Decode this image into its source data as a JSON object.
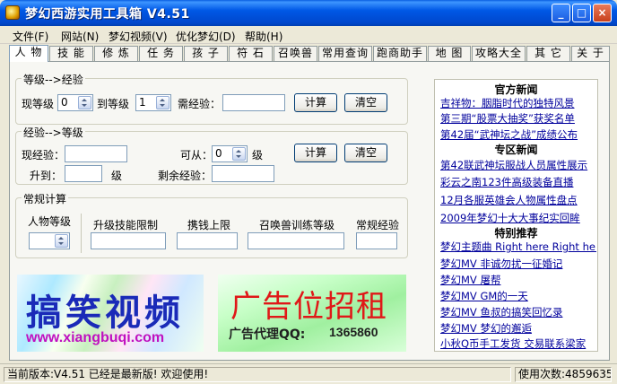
{
  "window": {
    "title": "梦幻西游实用工具箱 V4.51",
    "min_glyph": "_",
    "max_glyph": "□",
    "close_glyph": "×"
  },
  "menu": [
    "文件(F)",
    "网站(N)",
    "梦幻视频(V)",
    "优化梦幻(D)",
    "帮助(H)"
  ],
  "tabs": [
    "人 物",
    "技 能",
    "修 炼",
    "任 务",
    "孩 子",
    "符 石",
    "召唤兽",
    "常用查询",
    "跑商助手",
    "地 图",
    "攻略大全",
    "其 它",
    "关 于"
  ],
  "exp_calc": {
    "title": "等级-->经验",
    "current_level_label": "现等级",
    "current_level_value": "0",
    "to_level_label": "到等级",
    "to_level_value": "1",
    "need_exp_label": "需经验：",
    "need_exp_value": "",
    "calc_button": "计算",
    "clear_button": "清空"
  },
  "level_calc": {
    "title": "经验-->等级",
    "current_exp_label": "现经验：",
    "current_exp_value": "",
    "from_label": "可从：",
    "from_value": "0",
    "level_unit": "级",
    "up_to_label": "升到：",
    "up_to_value": "",
    "up_to_unit": "级",
    "remaining_exp_label": "剩余经验：",
    "remaining_exp_value": "",
    "calc_button": "计算",
    "clear_button": "清空"
  },
  "regular_calc": {
    "title": "常规计算",
    "char_level_label": "人物等级",
    "char_level_value": "",
    "skill_limit_label": "升级技能限制",
    "money_limit_label": "携钱上限",
    "pet_training_label": "召唤兽训练等级",
    "regular_exp_label": "常规经验"
  },
  "banners": {
    "video_title": "搞笑视频",
    "video_url": "www.xiangbuqi.com",
    "ad_title": "广告位招租",
    "ad_sub": "广告代理QQ:",
    "ad_qq": "1365860"
  },
  "news": {
    "official_title": "官方新闻",
    "official": [
      "吉祥物：胭脂时代的独特风景",
      "第三期“股票大抽奖”获奖名单",
      "第42届“武神坛之战”成绩公布"
    ],
    "zone_title": "专区新闻",
    "zone": [
      "第42联武神坛服战人员属性展示",
      "彩云之南123件高级装备直播",
      "12月各服英雄会人物属性盘点",
      "2009年梦幻十大大事纪实回眸"
    ],
    "special_title": "特别推荐",
    "special": [
      "梦幻主题曲 Right here Right here",
      "梦幻MV 非诚勿扰一征婚记",
      "梦幻MV 屠帮",
      "梦幻MV GM的一天",
      "梦幻MV 鱼叔的搞笑回忆录",
      "梦幻MV 梦幻的邂逅",
      "小秋Q币手工发货 交易联系梁家"
    ]
  },
  "status": {
    "version_text": "当前版本:V4.51 已经是最新版! 欢迎使用!",
    "usage_text": "使用次数:48596357"
  }
}
